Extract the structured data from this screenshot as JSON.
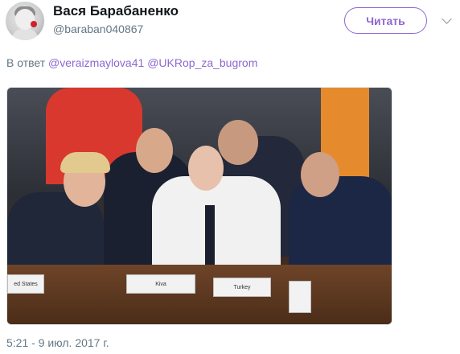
{
  "tweet": {
    "display_name": "Вася Барабаненко",
    "handle": "@baraban040867",
    "follow_label": "Читать",
    "reply_prefix": "В ответ",
    "reply_mentions": [
      "@veraizmaylova41",
      "@UKRop_za_bugrom"
    ],
    "timestamp": "5:21 - 9 июл. 2017 г."
  },
  "photo": {
    "nameplates": [
      "ed States",
      "Kiva",
      "Turkey"
    ]
  },
  "colors": {
    "accent": "#8e67d1",
    "secondary_text": "#657786",
    "primary_text": "#14171a"
  },
  "icons": {
    "menu": "chevron-down-icon"
  }
}
